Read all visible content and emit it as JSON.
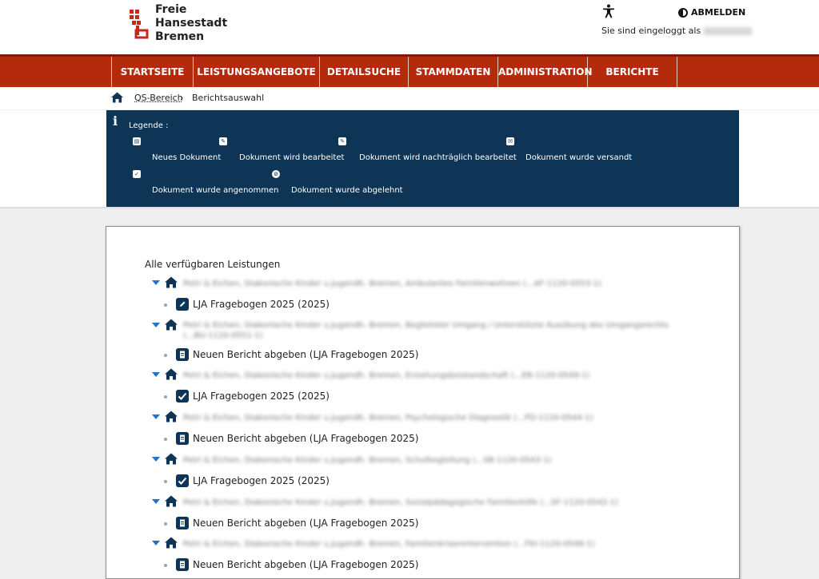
{
  "header": {
    "logo_lines": [
      "Freie",
      "Hansestadt",
      "Bremen"
    ],
    "logout_label": "ABMELDEN",
    "login_text": "Sie sind eingeloggt als"
  },
  "nav": {
    "items": [
      "STARTSEITE",
      "LEISTUNGSANGEBOTE",
      "DETAILSUCHE",
      "STAMMDATEN",
      "ADMINISTRATION",
      "BERICHTE"
    ]
  },
  "breadcrumb": {
    "items": [
      "QS-Bereich",
      "Berichtsauswahl"
    ]
  },
  "legend": {
    "title": "Legende :",
    "entries": [
      {
        "icon": "document-icon",
        "label": "Neues Dokument"
      },
      {
        "icon": "pencil-icon",
        "label": "Dokument wird bearbeitet"
      },
      {
        "icon": "pencil-icon",
        "label": "Dokument wird nachträglich bearbeitet"
      },
      {
        "icon": "envelope-icon",
        "label": "Dokument wurde versandt"
      },
      {
        "icon": "checkmark-icon",
        "label": "Dokument wurde angenommen"
      },
      {
        "icon": "ban-icon",
        "label": "Dokument wurde abgelehnt"
      }
    ]
  },
  "main": {
    "title": "Alle verfügbaren Leistungen",
    "groups": [
      {
        "provider": "Petri & Eichen, Diakonische Kinder u.Jugendh. Bremen, Ambulantes Familienwohnen (...AF-1120-0553-1)",
        "doc_icon": "pencil-icon",
        "doc_label": "LJA Fragebogen 2025 (2025)"
      },
      {
        "provider": "Petri & Eichen, Diakonische Kinder u.Jugendh. Bremen, Begleiteter Umgang / Unterstützte Ausübung des Umgangsrechts (...BU-1120-0551-1)",
        "doc_icon": "document-icon",
        "doc_label": "Neuen Bericht abgeben (LJA Fragebogen 2025)"
      },
      {
        "provider": "Petri & Eichen, Diakonische Kinder u.Jugendh. Bremen, Erziehungsbeistandschaft (...EB-1120-0549-1)",
        "doc_icon": "checkmark-icon",
        "doc_label": "LJA Fragebogen 2025 (2025)"
      },
      {
        "provider": "Petri & Eichen, Diakonische Kinder u.Jugendh. Bremen, Psychologische Diagnostik (...PD-1120-0544-1)",
        "doc_icon": "document-icon",
        "doc_label": "Neuen Bericht abgeben (LJA Fragebogen 2025)"
      },
      {
        "provider": "Petri & Eichen, Diakonische Kinder u.Jugendh. Bremen, Schulbegleitung (...SB-1120-0543-1)",
        "doc_icon": "checkmark-icon",
        "doc_label": "LJA Fragebogen 2025 (2025)"
      },
      {
        "provider": "Petri & Eichen, Diakonische Kinder u.Jugendh. Bremen, Sozialpädagogische Familienhilfe (...SF-1120-0542-1)",
        "doc_icon": "document-icon",
        "doc_label": "Neuen Bericht abgeben (LJA Fragebogen 2025)"
      },
      {
        "provider": "Petri & Eichen, Diakonische Kinder u.Jugendh. Bremen, Familienkrisenintervention (...FKI-1120-0548-1)",
        "doc_icon": "document-icon",
        "doc_label": "Neuen Bericht abgeben (LJA Fragebogen 2025)"
      }
    ]
  },
  "colors": {
    "nav_red": "#b42a0c",
    "legend_navy": "#0f3556",
    "caret_blue": "#1f73c8"
  }
}
